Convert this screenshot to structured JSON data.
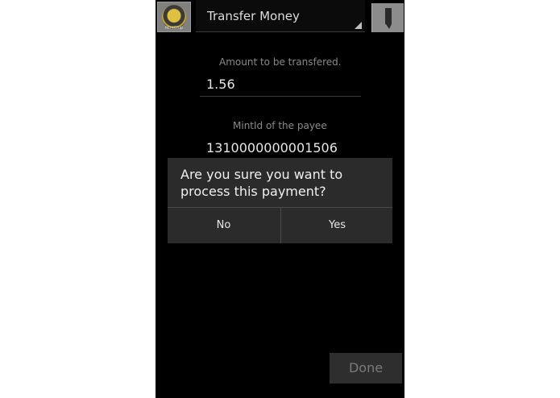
{
  "actionbar": {
    "title": "Transfer Money",
    "app_icon_text": "MintChip"
  },
  "form": {
    "amount_label": "Amount to be transfered.",
    "amount_value": "1.56",
    "payee_label": "MintId of the payee",
    "payee_value": "1310000000001506"
  },
  "dialog": {
    "message": "Are you sure you want to process this payment?",
    "no_label": "No",
    "yes_label": "Yes"
  },
  "footer": {
    "done_label": "Done"
  },
  "icons": [
    "app-icon",
    "spinner-arrow-icon",
    "overflow-menu-icon"
  ],
  "colors": {
    "background": "#000000",
    "dialog": "#2b2b2b",
    "label": "#8a8a8a",
    "text": "#e6e6e6"
  }
}
